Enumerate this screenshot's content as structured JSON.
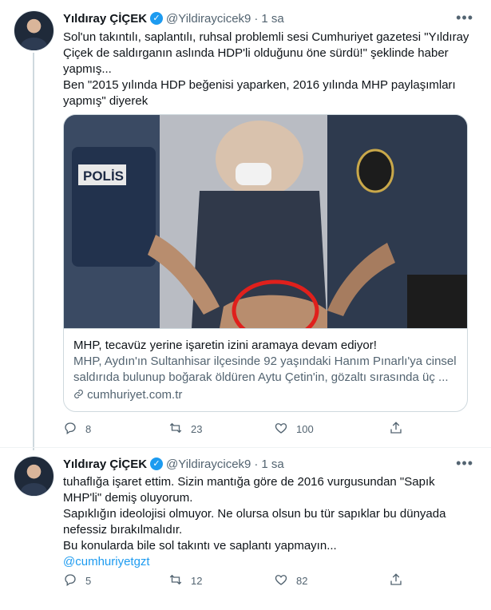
{
  "tweets": [
    {
      "author": "Yıldıray ÇİÇEK",
      "verified_mark": "✓",
      "handle": "@Yildiraycicek9",
      "dot": "·",
      "time": "1 sa",
      "more": "•••",
      "lines": [
        "Sol'un takıntılı, saplantılı, ruhsal problemli sesi Cumhuriyet gazetesi  \"Yıldıray Çiçek de saldırganın aslında HDP'li olduğunu öne sürdü!\" şeklinde haber yapmış...",
        "Ben \"2015 yılında HDP beğenisi yaparken, 2016 yılında MHP paylaşımları yapmış\" diyerek"
      ],
      "card": {
        "title": "MHP, tecavüz yerine işaretin izini aramaya devam ediyor!",
        "description": "MHP, Aydın'ın Sultanhisar ilçesinde 92 yaşındaki Hanım Pınarlı'ya cinsel saldırıda bulunup boğarak öldüren Aytu Çetin'in, gözaltı sırasında üç ...",
        "domain": "cumhuriyet.com.tr",
        "image_vest_text": "POLİS"
      },
      "stats": {
        "replies": "8",
        "retweets": "23",
        "likes": "100"
      }
    },
    {
      "author": "Yıldıray ÇİÇEK",
      "verified_mark": "✓",
      "handle": "@Yildiraycicek9",
      "dot": "·",
      "time": "1 sa",
      "more": "•••",
      "lines": [
        "tuhaflığa işaret ettim. Sizin mantığa göre de 2016 vurgusundan \"Sapık MHP'li\" demiş oluyorum.",
        "Sapıklığın ideolojisi olmuyor. Ne olursa olsun bu tür sapıklar bu dünyada nefessiz bırakılmalıdır.",
        "Bu konularda bile sol takıntı ve saplantı yapmayın..."
      ],
      "mention": "@cumhuriyetgzt",
      "stats": {
        "replies": "5",
        "retweets": "12",
        "likes": "82"
      }
    }
  ],
  "icons": [
    "reply-icon",
    "retweet-icon",
    "like-icon",
    "share-icon",
    "link-icon",
    "verified-badge-icon",
    "more-icon"
  ],
  "colors": {
    "accent": "#1d9bf0",
    "text": "#0f1419",
    "secondary": "#536471",
    "border": "#cfd9de",
    "highlight_circle": "#e0201c"
  }
}
